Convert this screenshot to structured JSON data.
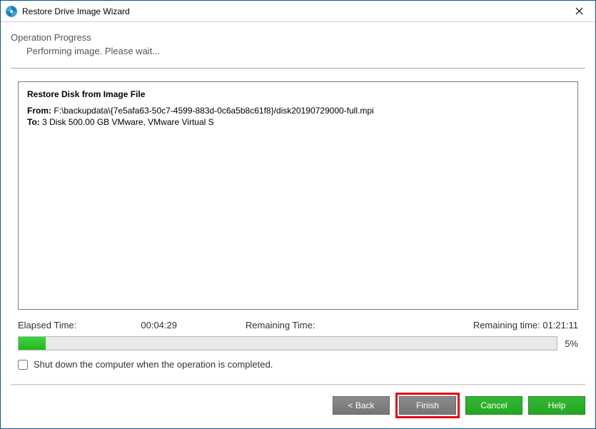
{
  "window": {
    "title": "Restore Drive Image Wizard"
  },
  "header": {
    "title": "Operation Progress",
    "subtitle": "Performing image. Please wait..."
  },
  "log": {
    "title": "Restore Disk from Image File",
    "from_label": "From:",
    "from_value": "F:\\backupdata\\{7e5afa63-50c7-4599-883d-0c6a5b8c61f8}/disk20190729000-full.mpi",
    "to_label": "To:",
    "to_value": "3 Disk 500.00 GB VMware, VMware Virtual S"
  },
  "timers": {
    "elapsed_label": "Elapsed Time:",
    "elapsed_value": "00:04:29",
    "remaining_label": "Remaining Time:",
    "remaining_value": "Remaining time: 01:21:11"
  },
  "progress": {
    "percent_text": "5%",
    "fill_width": "5%"
  },
  "shutdown": {
    "label": "Shut down the computer when the operation is completed."
  },
  "buttons": {
    "back": "< Back",
    "finish": "Finish",
    "cancel": "Cancel",
    "help": "Help"
  }
}
